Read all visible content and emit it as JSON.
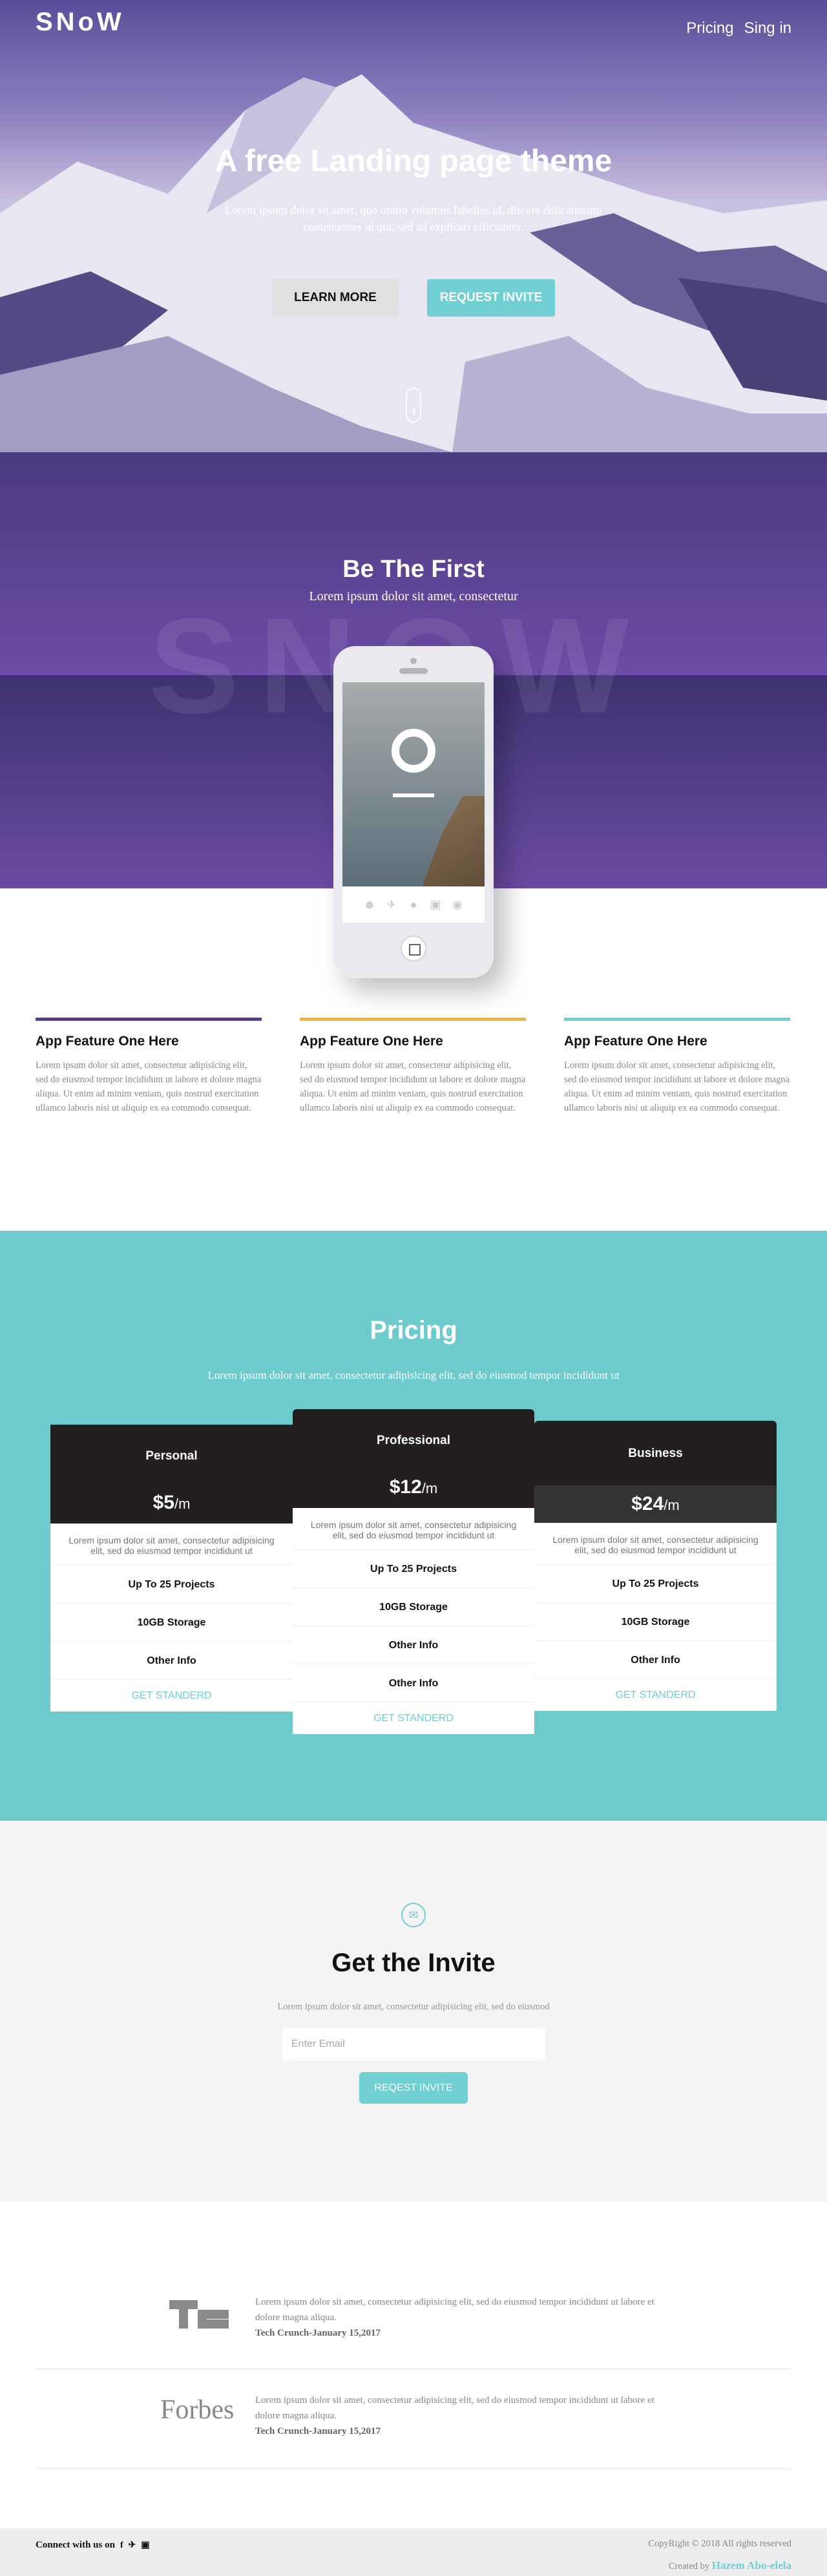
{
  "nav": {
    "logo": "SNoW",
    "links": [
      "Pricing",
      "Sing in"
    ]
  },
  "hero": {
    "title": "A free Landing page theme",
    "subtitle": "Lorem ipsum dolor sit amet, quo oratio volumus fabellas id, discere delicatissimi contentiones id qui, sed ad explicari efficiantur.",
    "learn_more": "LEARN MORE",
    "request_invite": "REQUEST INVITE"
  },
  "first": {
    "title": "Be The First",
    "subtitle": "Lorem ipsum dolor sit amet, consectetur",
    "watermark": "SNOW"
  },
  "features": [
    {
      "title": "App Feature One Here",
      "text": "Lorem ipsum dolor sit amet, consectetur adipisicing elit, sed do eiusmod tempor incididunt ut labore et dolore magna aliqua. Ut enim ad minim veniam, quis nostrud exercitation ullamco laboris nisi ut aliquip ex ea commodo consequat.",
      "color": "#5b3a92"
    },
    {
      "title": "App Feature One Here",
      "text": "Lorem ipsum dolor sit amet, consectetur adipisicing elit, sed do eiusmod tempor incididunt ut labore et dolore magna aliqua. Ut enim ad minim veniam, quis nostrud exercitation ullamco laboris nisi ut aliquip ex ea commodo consequat.",
      "color": "#f1b33e"
    },
    {
      "title": "App Feature One Here",
      "text": "Lorem ipsum dolor sit amet, consectetur adipisicing elit, sed do eiusmod tempor incididunt ut labore et dolore magna aliqua. Ut enim ad minim veniam, quis nostrud exercitation ullamco laboris nisi ut aliquip ex ea commodo consequat.",
      "color": "#6fcfd2"
    }
  ],
  "pricing": {
    "title": "Pricing",
    "subtitle": "Lorem ipsum dolor sit amet, consectetur adipisicing elit, sed do eiusmod tempor incididunt ut",
    "plans": [
      {
        "name": "Personal",
        "price": "$5",
        "unit": "/m",
        "desc": "Lorem ipsum dolor sit amet, consectetur adipisicing elit, sed do eiusmod tempor incididunt ut",
        "features": [
          "Up To 25 Projects",
          "10GB Storage",
          "Other Info"
        ],
        "cta": "GET STANDERD"
      },
      {
        "name": "Professional",
        "price": "$12",
        "unit": "/m",
        "desc": "Lorem ipsum dolor sit amet, consectetur adipisicing elit, sed do eiusmod tempor incididunt ut",
        "features": [
          "Up To 25 Projects",
          "10GB Storage",
          "Other Info",
          "Other Info"
        ],
        "cta": "GET STANDERD"
      },
      {
        "name": "Business",
        "price": "$24",
        "unit": "/m",
        "desc": "Lorem ipsum dolor sit amet, consectetur adipisicing elit, sed do eiusmod tempor incididunt ut",
        "features": [
          "Up To 25 Projects",
          "10GB Storage",
          "Other Info"
        ],
        "cta": "GET STANDERD"
      }
    ]
  },
  "invite": {
    "title": "Get the Invite",
    "subtitle": "Lorem ipsum dolor sit amet, consectetur adipisicing elit, sed do eiusmod",
    "email_placeholder": "Enter Email",
    "button": "REQEST INVITE"
  },
  "press": [
    {
      "logo": "TC",
      "text": "Lorem ipsum dolor sit amet, consectetur adipisicing elit, sed do eiusmod tempor incididunt ut labore et dolore magna aliqua.",
      "source": "Tech Crunch-January 15,2017"
    },
    {
      "logo": "Forbes",
      "text": "Lorem ipsum dolor sit amet, consectetur adipisicing elit, sed do eiusmod tempor incididunt ut labore et dolore magna aliqua.",
      "source": "Tech Crunch-January 15,2017"
    }
  ],
  "footer": {
    "connect": "Connect with us on",
    "social_icons": [
      "facebook-icon",
      "twitter-icon",
      "instagram-icon"
    ],
    "copyright": "CopyRight © 2018 All rights reserved",
    "created_by": "Created by",
    "author": "Hazem Abo-elela"
  },
  "colors": {
    "accent": "#6fcfd2",
    "purple": "#5b3a92",
    "yellow": "#f1b33e",
    "dark": "#231f20"
  }
}
